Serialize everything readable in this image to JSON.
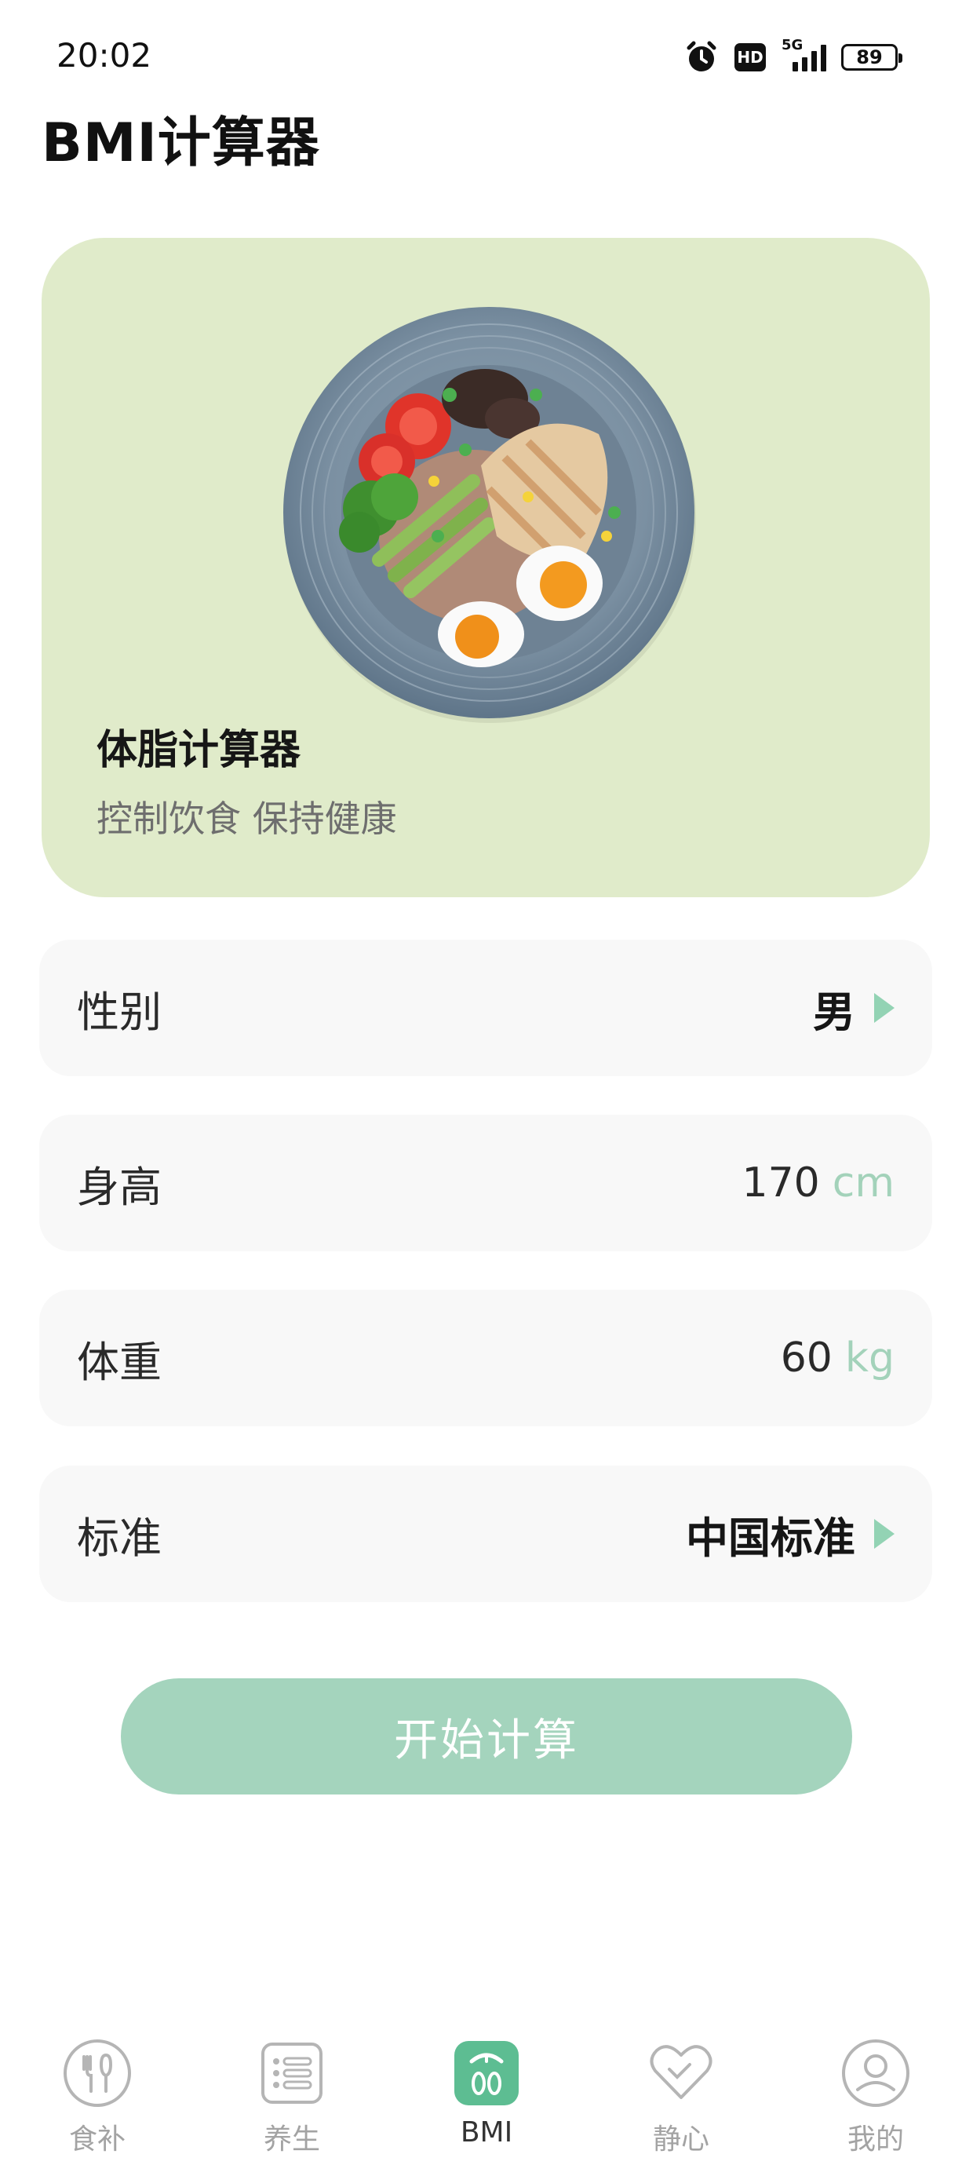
{
  "status_bar": {
    "time": "20:02",
    "hd": "HD",
    "network": "5G",
    "battery": "89"
  },
  "header": {
    "title": "BMI计算器"
  },
  "hero": {
    "title": "体脂计算器",
    "subtitle": "控制饮食 保持健康",
    "background_color": "#e0ebca",
    "image": "salad-bowl-illustration"
  },
  "form": {
    "gender": {
      "label": "性别",
      "value": "男"
    },
    "height": {
      "label": "身高",
      "value": "170",
      "unit": "cm"
    },
    "weight": {
      "label": "体重",
      "value": "60",
      "unit": "kg"
    },
    "standard": {
      "label": "标准",
      "value": "中国标准"
    }
  },
  "actions": {
    "start_label": "开始计算"
  },
  "colors": {
    "accent": "#a4d4bd",
    "accent_dark": "#5dbd92",
    "arrow": "#93d3b4",
    "unit": "#a3d2ba",
    "row_bg": "#f8f8f8"
  },
  "tabs": [
    {
      "label": "食补",
      "icon": "fork-spoon-icon",
      "active": false
    },
    {
      "label": "养生",
      "icon": "list-icon",
      "active": false
    },
    {
      "label": "BMI",
      "icon": "scale-icon",
      "active": true
    },
    {
      "label": "静心",
      "icon": "heart-icon",
      "active": false
    },
    {
      "label": "我的",
      "icon": "profile-icon",
      "active": false
    }
  ]
}
